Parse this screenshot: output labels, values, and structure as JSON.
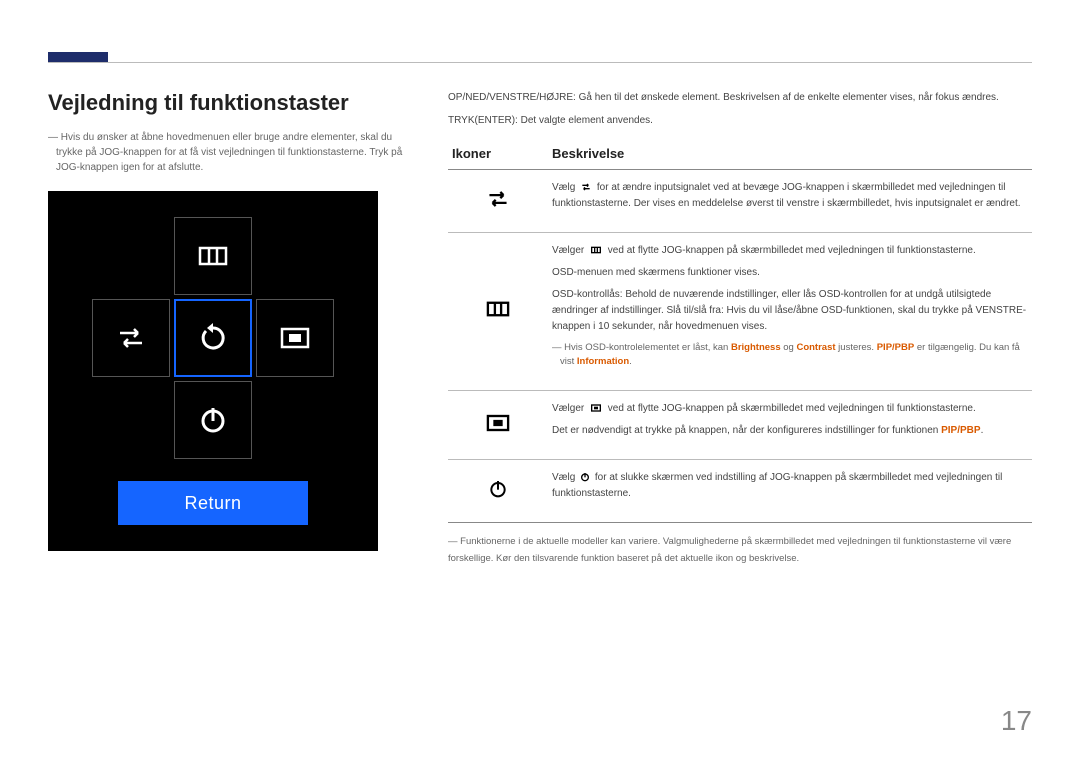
{
  "title": "Vejledning til funktionstaster",
  "intro_note": "Hvis du ønsker at åbne hovedmenuen eller bruge andre elementer, skal du trykke på JOG-knappen for at få vist vejledningen til funktionstasterne. Tryk på JOG-knappen igen for at afslutte.",
  "osd": {
    "return_label": "Return"
  },
  "right_top": {
    "line1": "OP/NED/VENSTRE/HØJRE: Gå hen til det ønskede element. Beskrivelsen af de enkelte elementer vises, når fokus ændres.",
    "line2": "TRYK(ENTER): Det valgte element anvendes."
  },
  "table": {
    "headers": {
      "icons": "Ikoner",
      "desc": "Beskrivelse"
    },
    "rows": [
      {
        "icon": "swap",
        "p1_a": "Vælg ",
        "p1_b": " for at ændre inputsignalet ved at bevæge JOG-knappen i skærmbilledet med vejledningen til funktionstasterne. Der vises en meddelelse øverst til venstre i skærmbilledet, hvis inputsignalet er ændret."
      },
      {
        "icon": "menu",
        "p1_a": "Vælger ",
        "p1_b": " ved at flytte JOG-knappen på skærmbilledet med vejledningen til funktionstasterne.",
        "p2": "OSD-menuen med skærmens funktioner vises.",
        "p3": "OSD-kontrollås: Behold de nuværende indstillinger, eller lås OSD-kontrollen for at undgå utilsigtede ændringer af indstillinger. Slå til/slå fra: Hvis du vil låse/åbne OSD-funktionen, skal du trykke på VENSTRE-knappen i 10 sekunder, når hovedmenuen vises.",
        "note_a": "Hvis OSD-kontrolelementet er låst, kan ",
        "note_b": " og ",
        "note_c": " justeres. ",
        "note_d": " er tilgængelig. Du kan få vist ",
        "hl_brightness": "Brightness",
        "hl_contrast": "Contrast",
        "hl_pipbp": "PIP/PBP",
        "hl_info": "Information",
        "note_e": "."
      },
      {
        "icon": "pip",
        "p1_a": "Vælger ",
        "p1_b": " ved at flytte JOG-knappen på skærmbilledet med vejledningen til funktionstasterne.",
        "p2_a": "Det er nødvendigt at trykke på knappen, når der konfigureres indstillinger for funktionen ",
        "p2_b": ".",
        "hl_pipbp": "PIP/PBP"
      },
      {
        "icon": "power",
        "p1_a": "Vælg ",
        "p1_b": " for at slukke skærmen ved indstilling af JOG-knappen på skærmbilledet med vejledningen til funktionstasterne."
      }
    ],
    "footer_note": "Funktionerne i de aktuelle modeller kan variere. Valgmulighederne på skærmbilledet med vejledningen til funktionstasterne vil være forskellige. Kør den tilsvarende funktion baseret på det aktuelle ikon og beskrivelse."
  },
  "page_number": "17"
}
